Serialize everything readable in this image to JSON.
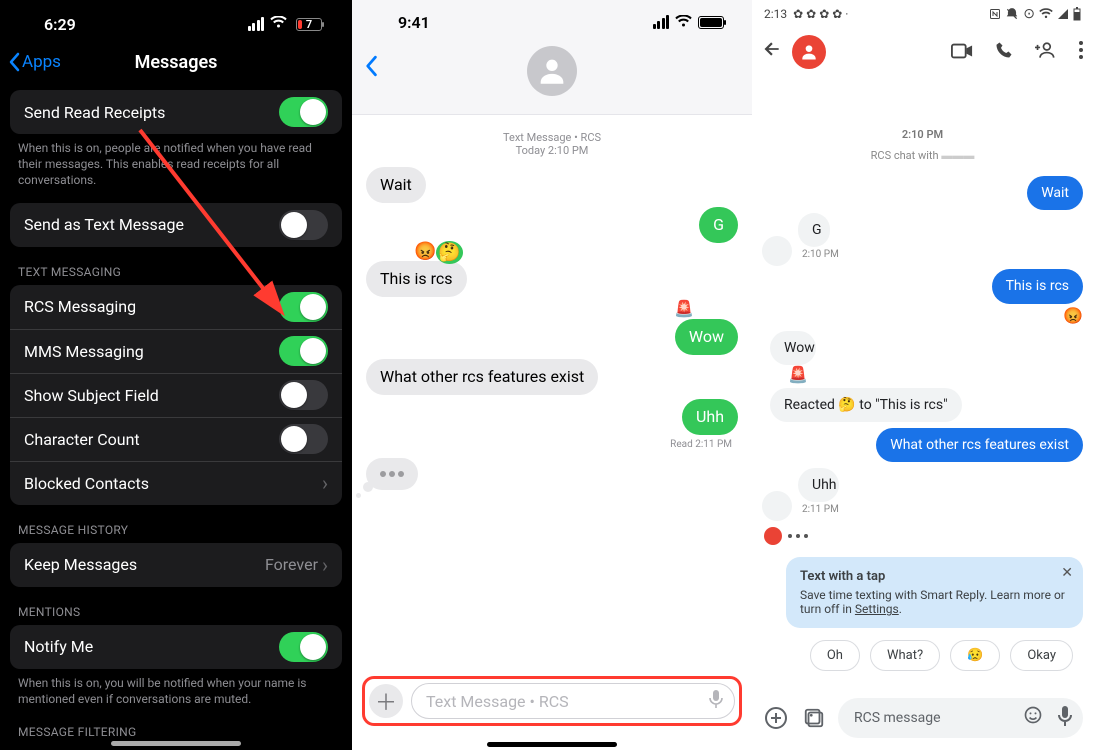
{
  "panel1": {
    "status": {
      "time": "6:29",
      "battery": "7"
    },
    "nav": {
      "back": "Apps",
      "title": "Messages"
    },
    "rows": {
      "sendReadReceipts": {
        "label": "Send Read Receipts",
        "on": true,
        "footer": "When this is on, people are notified when you have read their messages. This enables read receipts for all conversations."
      },
      "sendAsText": {
        "label": "Send as Text Message",
        "on": false
      },
      "textMessagingHeader": "TEXT MESSAGING",
      "rcs": {
        "label": "RCS Messaging",
        "on": true
      },
      "mms": {
        "label": "MMS Messaging",
        "on": true
      },
      "subject": {
        "label": "Show Subject Field",
        "on": false
      },
      "charCount": {
        "label": "Character Count",
        "on": false
      },
      "blocked": {
        "label": "Blocked Contacts"
      },
      "historyHeader": "MESSAGE HISTORY",
      "keep": {
        "label": "Keep Messages",
        "value": "Forever"
      },
      "mentionsHeader": "MENTIONS",
      "notify": {
        "label": "Notify Me",
        "on": true,
        "footer": "When this is on, you will be notified when your name is mentioned even if conversations are muted."
      },
      "filteringHeader": "MESSAGE FILTERING"
    }
  },
  "panel2": {
    "status": {
      "time": "9:41"
    },
    "thread": {
      "headerLine1": "Text Message • RCS",
      "headerLine2": "Today 2:10 PM",
      "msgs": {
        "m1": "Wait",
        "m2": "G",
        "m3": "This is rcs",
        "m4": "Wow",
        "m5": "What other rcs features exist",
        "m6": "Uhh"
      },
      "read": "Read 2:11 PM",
      "reactions": {
        "angry": "😡",
        "thinking": "🤔",
        "siren": "🚨"
      }
    },
    "composer": {
      "placeholder": "Text Message • RCS"
    }
  },
  "panel3": {
    "status": {
      "time": "2:13"
    },
    "centerTs": "2:10 PM",
    "centerInfo": "RCS chat with",
    "msgs": {
      "m1": "Wait",
      "m2": "G",
      "m2ts": "2:10 PM",
      "m3": "This is rcs",
      "m4": "Wow",
      "m5": "Reacted 🤔 to \"This is rcs\"",
      "m6": "What other rcs features exist",
      "m7": "Uhh",
      "m7ts": "2:11 PM",
      "angry": "😡",
      "siren": "🚨"
    },
    "smartReply": {
      "title": "Text with a tap",
      "body1": "Save time texting with Smart Reply. Learn more or turn off in ",
      "link": "Settings",
      "body2": "."
    },
    "chips": {
      "c1": "Oh",
      "c2": "What?",
      "c3": "😥",
      "c4": "Okay"
    },
    "composer": {
      "placeholder": "RCS message"
    }
  }
}
